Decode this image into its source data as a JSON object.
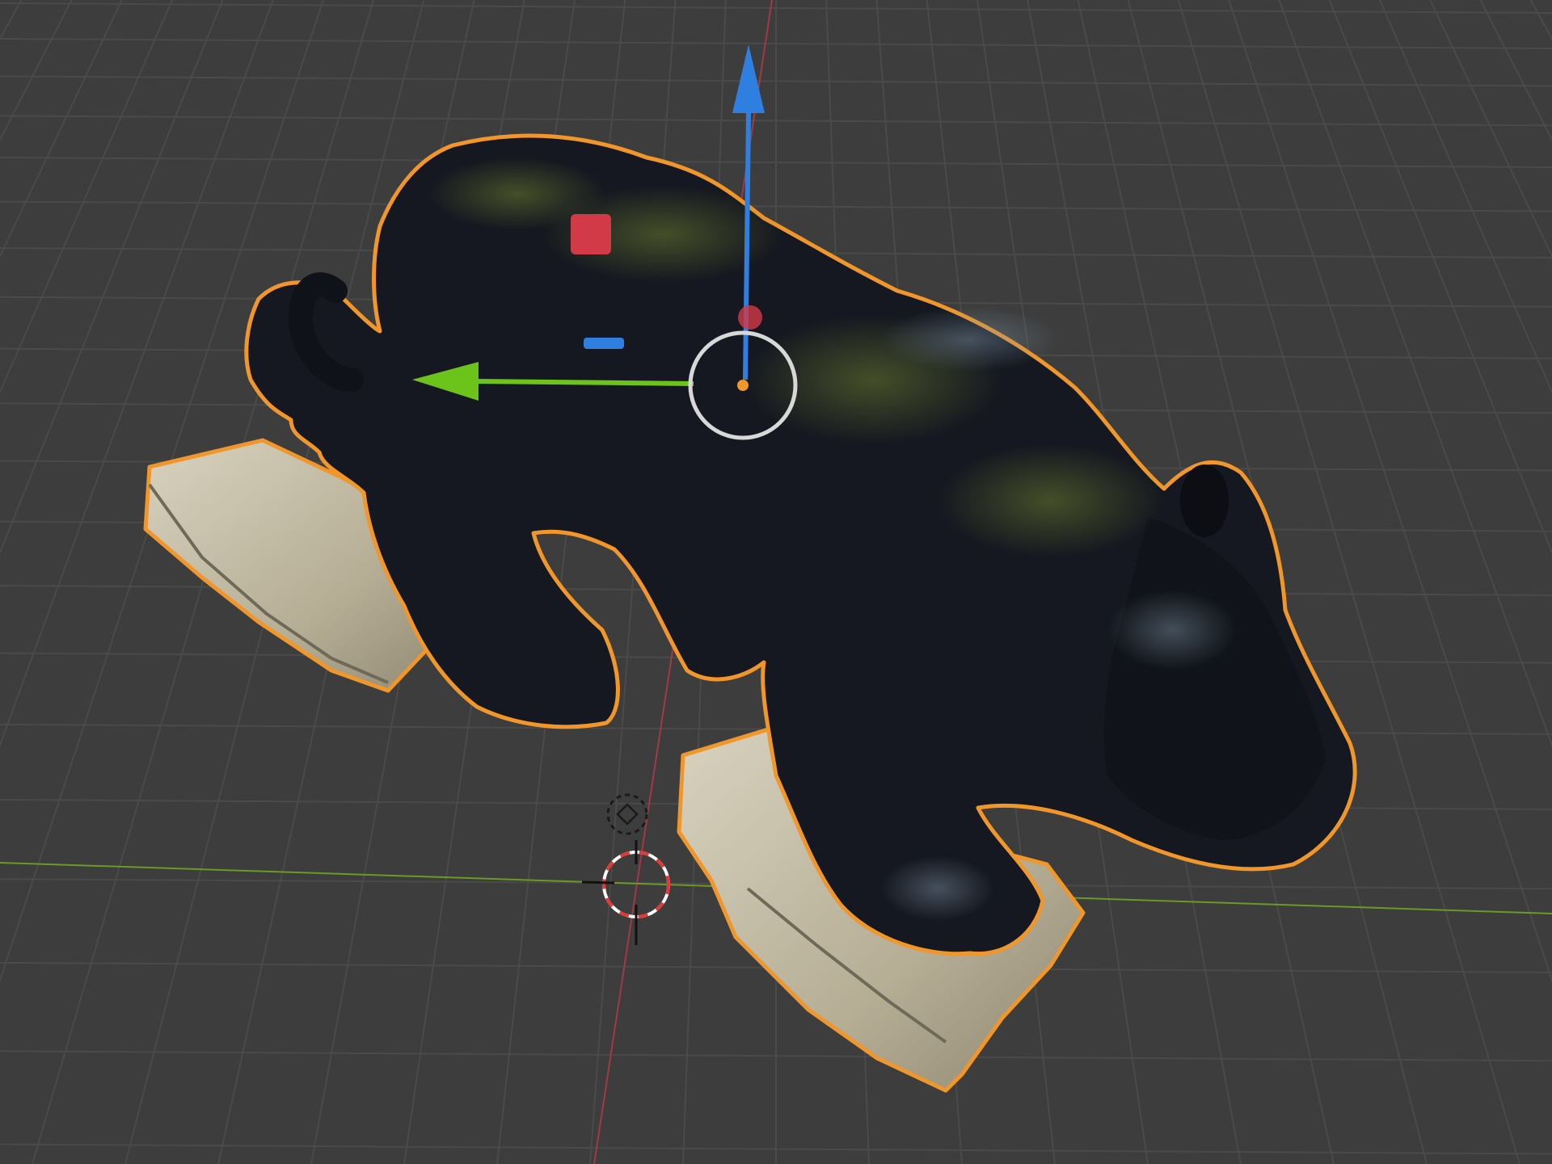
{
  "viewport": {
    "editor": "3d-viewport",
    "background_color": "#3d3d3d",
    "grid_color": "#4a4a4a",
    "x_axis_color": "#a13a45",
    "y_axis_color": "#6a9a23"
  },
  "selected_object": {
    "kind": "scanned-statue-mesh",
    "selected": true,
    "outline_color": "#f0962a",
    "body_color": "#151820",
    "moss_color": "#5a6a2c",
    "base_color": "#c9c3b0"
  },
  "gizmo": {
    "tool": "move",
    "z_arrow_color": "#2f7fe0",
    "y_arrow_color": "#6cc41a",
    "x_plane_handle_color": "#d23a48",
    "z_plane_handle_color": "#2f7fe0",
    "origin_color": "#f0962a",
    "view_ring_color": "#d8d8d8"
  },
  "scene_markers": {
    "light_icon": "light-icon",
    "cursor_icon": "3d-cursor-icon"
  }
}
